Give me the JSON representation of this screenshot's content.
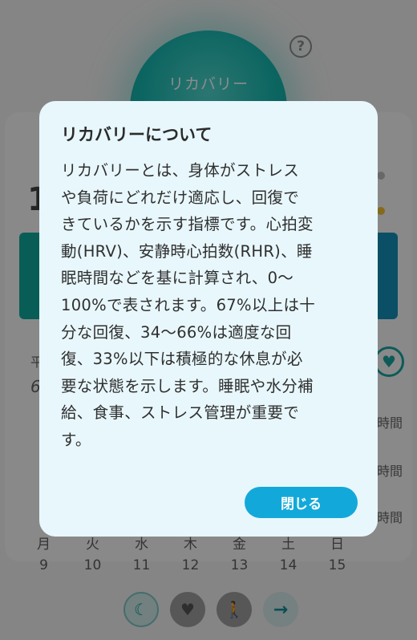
{
  "recovery": {
    "circle_label": "リカバリー"
  },
  "background": {
    "big_number": "1",
    "left_label_1": "平",
    "left_value_1": "6",
    "time_labels": [
      "時間",
      "時間",
      "時間"
    ]
  },
  "week": {
    "days": [
      {
        "weekday": "月",
        "date": "9"
      },
      {
        "weekday": "火",
        "date": "10"
      },
      {
        "weekday": "水",
        "date": "11"
      },
      {
        "weekday": "木",
        "date": "12"
      },
      {
        "weekday": "金",
        "date": "13"
      },
      {
        "weekday": "土",
        "date": "14"
      },
      {
        "weekday": "日",
        "date": "15"
      }
    ]
  },
  "modal": {
    "title": "リカバリーについて",
    "body": "リカバリーとは、身体がストレス\nや負荷にどれだけ適応し、回復で\nきているかを示す指標です。心拍変\n動(HRV)、安静時心拍数(RHR)、睡\n眠時間などを基に計算され、0〜\n100%で表されます。67%以上は十\n分な回復、34〜66%は適度な回\n復、33%以下は積極的な休息が必\n要な状態を示します。睡眠や水分補\n給、食事、ストレス管理が重要で\nす。",
    "close_label": "閉じる"
  },
  "colors": {
    "accent": "#12a9da",
    "recovery": "#17b8b0",
    "modal_bg": "#e8f7fc"
  }
}
